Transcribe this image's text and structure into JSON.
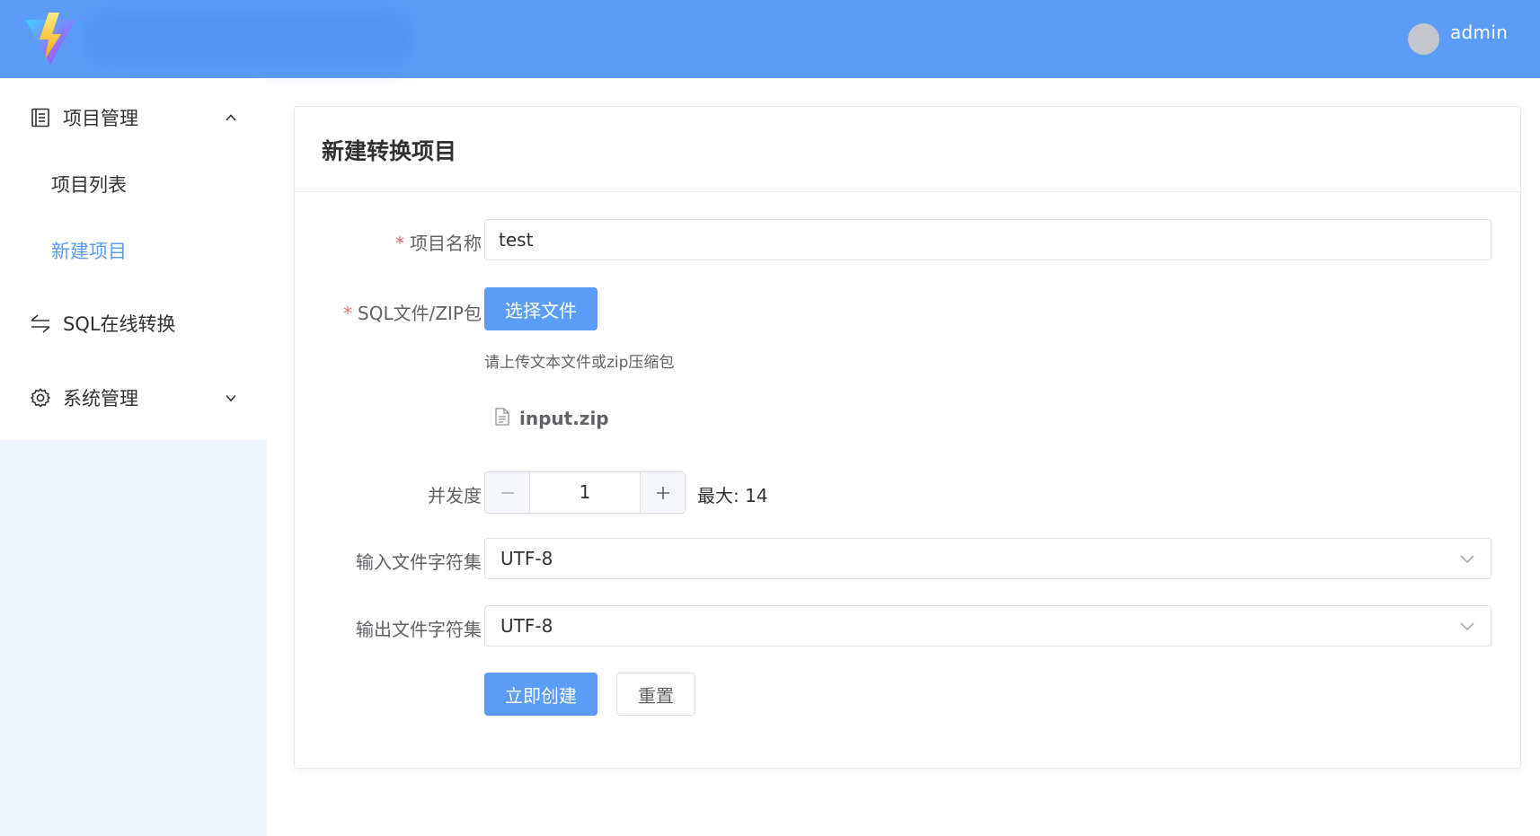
{
  "header": {
    "username": "admin"
  },
  "sidebar": {
    "menu": [
      {
        "label": "项目管理",
        "icon": "document-icon",
        "expanded": true,
        "children": [
          {
            "label": "项目列表",
            "active": false
          },
          {
            "label": "新建项目",
            "active": true
          }
        ]
      },
      {
        "label": "SQL在线转换",
        "icon": "switch-arrows-icon"
      },
      {
        "label": "系统管理",
        "icon": "gear-icon",
        "expanded": false
      }
    ]
  },
  "form": {
    "title": "新建转换项目",
    "project_name": {
      "required_mark": "*",
      "label": "项目名称",
      "value": "test"
    },
    "upload": {
      "required_mark": "*",
      "label": "SQL文件/ZIP包",
      "button_label": "选择文件",
      "tip": "请上传文本文件或zip压缩包",
      "file_name": "input.zip",
      "file_icon": "file-icon"
    },
    "concurrency": {
      "label": "并发度",
      "value": "1",
      "max_text": "最大: 14"
    },
    "input_charset": {
      "label": "输入文件字符集",
      "value": "UTF-8"
    },
    "output_charset": {
      "label": "输出文件字符集",
      "value": "UTF-8"
    },
    "submit_label": "立即创建",
    "reset_label": "重置"
  },
  "colors": {
    "primary": "#5b9cf8",
    "required": "#f56c6c",
    "sidebar_bg": "#eef5ff"
  }
}
